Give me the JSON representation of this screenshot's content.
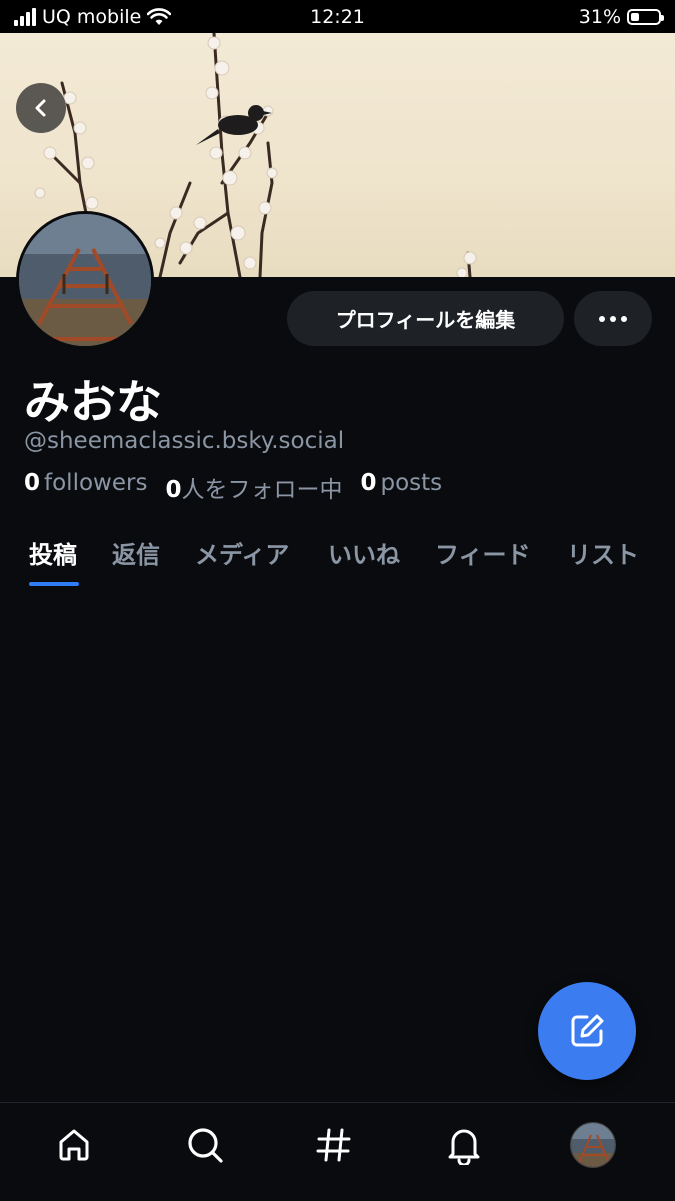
{
  "status_bar": {
    "carrier": "UQ mobile",
    "time": "12:21",
    "battery_percent": "31%",
    "battery_level": 0.31,
    "signal_icon": "cellular-signal-icon",
    "wifi_icon": "wifi-icon"
  },
  "profile": {
    "display_name": "みおな",
    "handle": "@sheemaclassic.bsky.social",
    "followers_count": "0",
    "followers_label": "followers",
    "following_count": "0",
    "following_label": "人をフォロー中",
    "posts_count": "0",
    "posts_label": "posts"
  },
  "actions": {
    "edit_profile_label": "プロフィールを編集",
    "more_icon": "more-horizontal-icon",
    "back_icon": "chevron-left-icon"
  },
  "tabs": [
    {
      "label": "投稿",
      "active": true
    },
    {
      "label": "返信",
      "active": false
    },
    {
      "label": "メディア",
      "active": false
    },
    {
      "label": "いいね",
      "active": false
    },
    {
      "label": "フィード",
      "active": false
    },
    {
      "label": "リスト",
      "active": false
    }
  ],
  "fab": {
    "icon": "compose-icon"
  },
  "bottom_nav": [
    {
      "icon": "home-icon"
    },
    {
      "icon": "search-icon"
    },
    {
      "icon": "hashtag-icon"
    },
    {
      "icon": "bell-icon"
    },
    {
      "icon": "profile-avatar-icon"
    }
  ],
  "colors": {
    "background": "#0a0b0e",
    "accent": "#2f7ef5",
    "fab": "#3b7cf0",
    "muted_text": "#8b96a5",
    "button_bg": "#1e2126"
  }
}
